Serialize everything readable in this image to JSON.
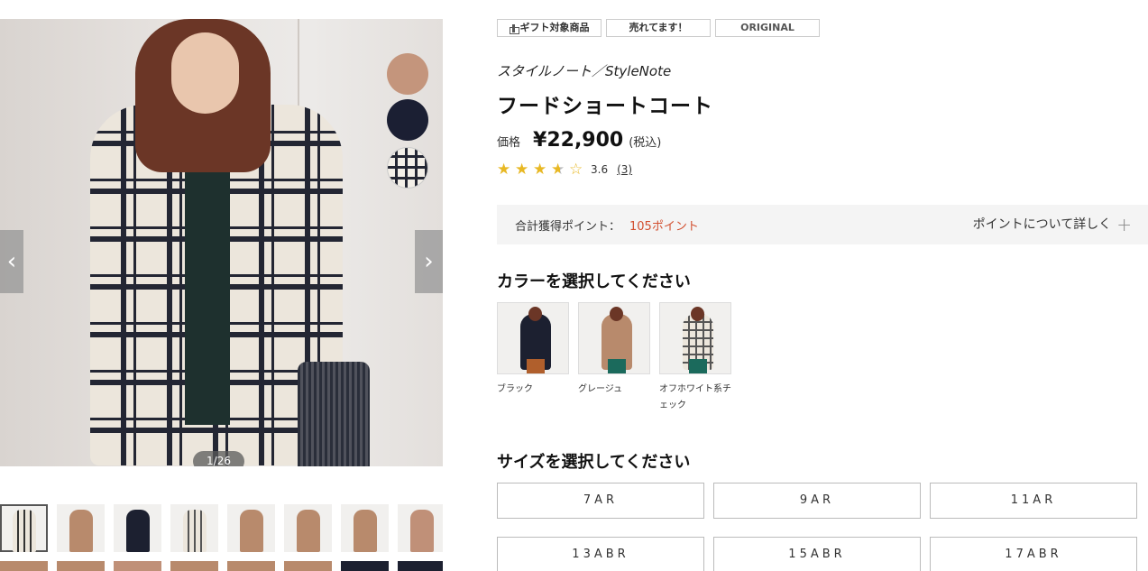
{
  "gallery": {
    "counter": "1/26",
    "prev_icon": "chevron-left-icon",
    "next_icon": "chevron-right-icon",
    "swatches": [
      {
        "color": "#c4957c"
      },
      {
        "color": "#1b1f33"
      },
      {
        "color": "#f3efe8"
      }
    ]
  },
  "tags": {
    "gift": "ギフト対象商品",
    "selling": "売れてます！",
    "original": "ORIGINAL"
  },
  "product": {
    "brand": "スタイルノート／StyleNote",
    "title": "フードショートコート",
    "price_label": "価格",
    "price": "¥22,900",
    "tax": "(税込)",
    "rating": "3.6",
    "rating_stars": 3.5,
    "review_count": "(3)"
  },
  "points": {
    "label": "合計獲得ポイント：",
    "value": "105ポイント",
    "link": "ポイントについて詳しく",
    "accent": "#d24f2f"
  },
  "color_section": {
    "title": "カラーを選択してください",
    "options": [
      {
        "name": "ブラック"
      },
      {
        "name": "グレージュ"
      },
      {
        "name": "オフホワイト系チェック"
      }
    ]
  },
  "size_section": {
    "title": "サイズを選択してください",
    "sizes": [
      "7AR",
      "9AR",
      "11AR",
      "13ABR",
      "15ABR",
      "17ABR"
    ]
  }
}
